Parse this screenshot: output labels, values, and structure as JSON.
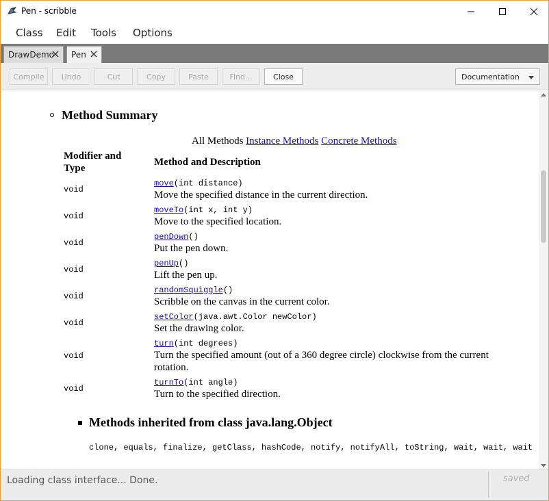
{
  "window": {
    "title": "Pen - scribble",
    "accent": "#e8a33c"
  },
  "menu": [
    "Class",
    "Edit",
    "Tools",
    "Options"
  ],
  "tabs": [
    {
      "label": "DrawDemo",
      "active": false
    },
    {
      "label": "Pen",
      "active": true
    }
  ],
  "toolbar": {
    "compile": "Compile",
    "undo": "Undo",
    "cut": "Cut",
    "copy": "Copy",
    "paste": "Paste",
    "find": "Find...",
    "close": "Close",
    "view_mode": "Documentation"
  },
  "doc": {
    "method_summary_title": "Method Summary",
    "filter_all": "All Methods",
    "filter_instance": "Instance Methods",
    "filter_concrete": "Concrete Methods",
    "col_modifier": "Modifier and Type",
    "col_method": "Method and Description",
    "methods": [
      {
        "type": "void",
        "name": "move",
        "params": "(int distance)",
        "desc": "Move the specified distance in the current direction."
      },
      {
        "type": "void",
        "name": "moveTo",
        "params": "(int x, int y)",
        "desc": "Move to the specified location."
      },
      {
        "type": "void",
        "name": "penDown",
        "params": "()",
        "desc": "Put the pen down."
      },
      {
        "type": "void",
        "name": "penUp",
        "params": "()",
        "desc": "Lift the pen up."
      },
      {
        "type": "void",
        "name": "randomSquiggle",
        "params": "()",
        "desc": "Scribble on the canvas in the current color."
      },
      {
        "type": "void",
        "name": "setColor",
        "params": "(java.awt.Color newColor)",
        "desc": "Set the drawing color."
      },
      {
        "type": "void",
        "name": "turn",
        "params": "(int degrees)",
        "desc": "Turn the specified amount (out of a 360 degree circle) clockwise from the current rotation."
      },
      {
        "type": "void",
        "name": "turnTo",
        "params": "(int angle)",
        "desc": "Turn to the specified direction."
      }
    ],
    "inherited_title": "Methods inherited from class java.lang.Object",
    "inherited_methods": "clone, equals, finalize, getClass, hashCode, notify, notifyAll, toString, wait, wait, wait"
  },
  "status": {
    "message": "Loading class interface... Done.",
    "saved": "saved"
  }
}
